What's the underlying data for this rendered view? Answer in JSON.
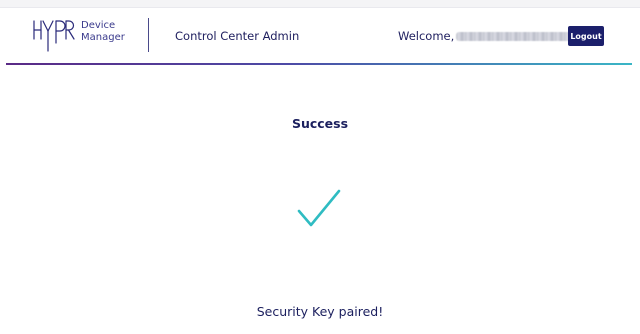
{
  "header": {
    "product_name_line1": "Device",
    "product_name_line2": "Manager",
    "app_title": "Control Center Admin",
    "welcome_label": "Welcome,",
    "logout_label": "Logout",
    "logo_icon": "hypr-logo",
    "accent_gradient": [
      "#5a2a86",
      "#4d4aa6",
      "#3ab6c6"
    ]
  },
  "content": {
    "title": "Success",
    "status_icon": "check-icon",
    "check_color": "#2fbcc2",
    "message": "Security Key paired!"
  }
}
